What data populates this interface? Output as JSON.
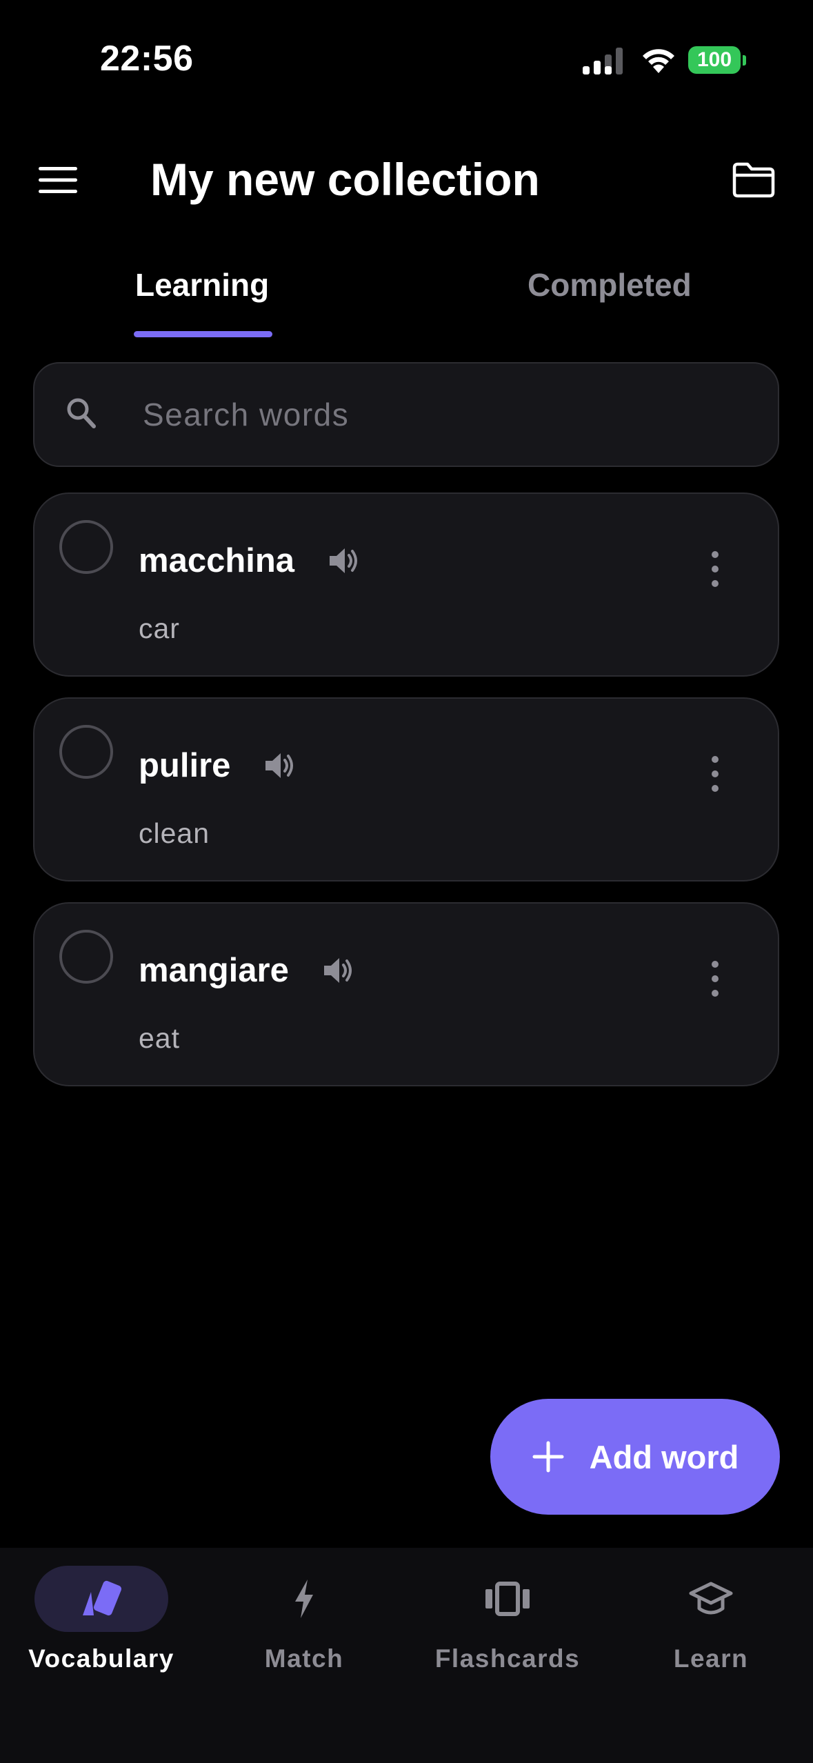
{
  "status_bar": {
    "time": "22:56",
    "battery": "100"
  },
  "header": {
    "title": "My new collection",
    "menu_icon": "hamburger-menu-icon",
    "folder_icon": "folder-icon"
  },
  "tabs": [
    {
      "label": "Learning",
      "active": true
    },
    {
      "label": "Completed",
      "active": false
    }
  ],
  "search": {
    "placeholder": "Search words",
    "value": ""
  },
  "words": [
    {
      "word": "macchina",
      "translation": "car"
    },
    {
      "word": "pulire",
      "translation": "clean"
    },
    {
      "word": "mangiare",
      "translation": "eat"
    }
  ],
  "add_button": {
    "label": "Add word"
  },
  "bottom_nav": [
    {
      "label": "Vocabulary",
      "icon": "cards-icon",
      "active": true
    },
    {
      "label": "Match",
      "icon": "lightning-icon",
      "active": false
    },
    {
      "label": "Flashcards",
      "icon": "flashcards-carousel-icon",
      "active": false
    },
    {
      "label": "Learn",
      "icon": "graduation-cap-icon",
      "active": false
    }
  ],
  "colors": {
    "accent": "#7b6cf6",
    "background": "#000000",
    "card": "#16161a",
    "battery": "#34c759"
  }
}
